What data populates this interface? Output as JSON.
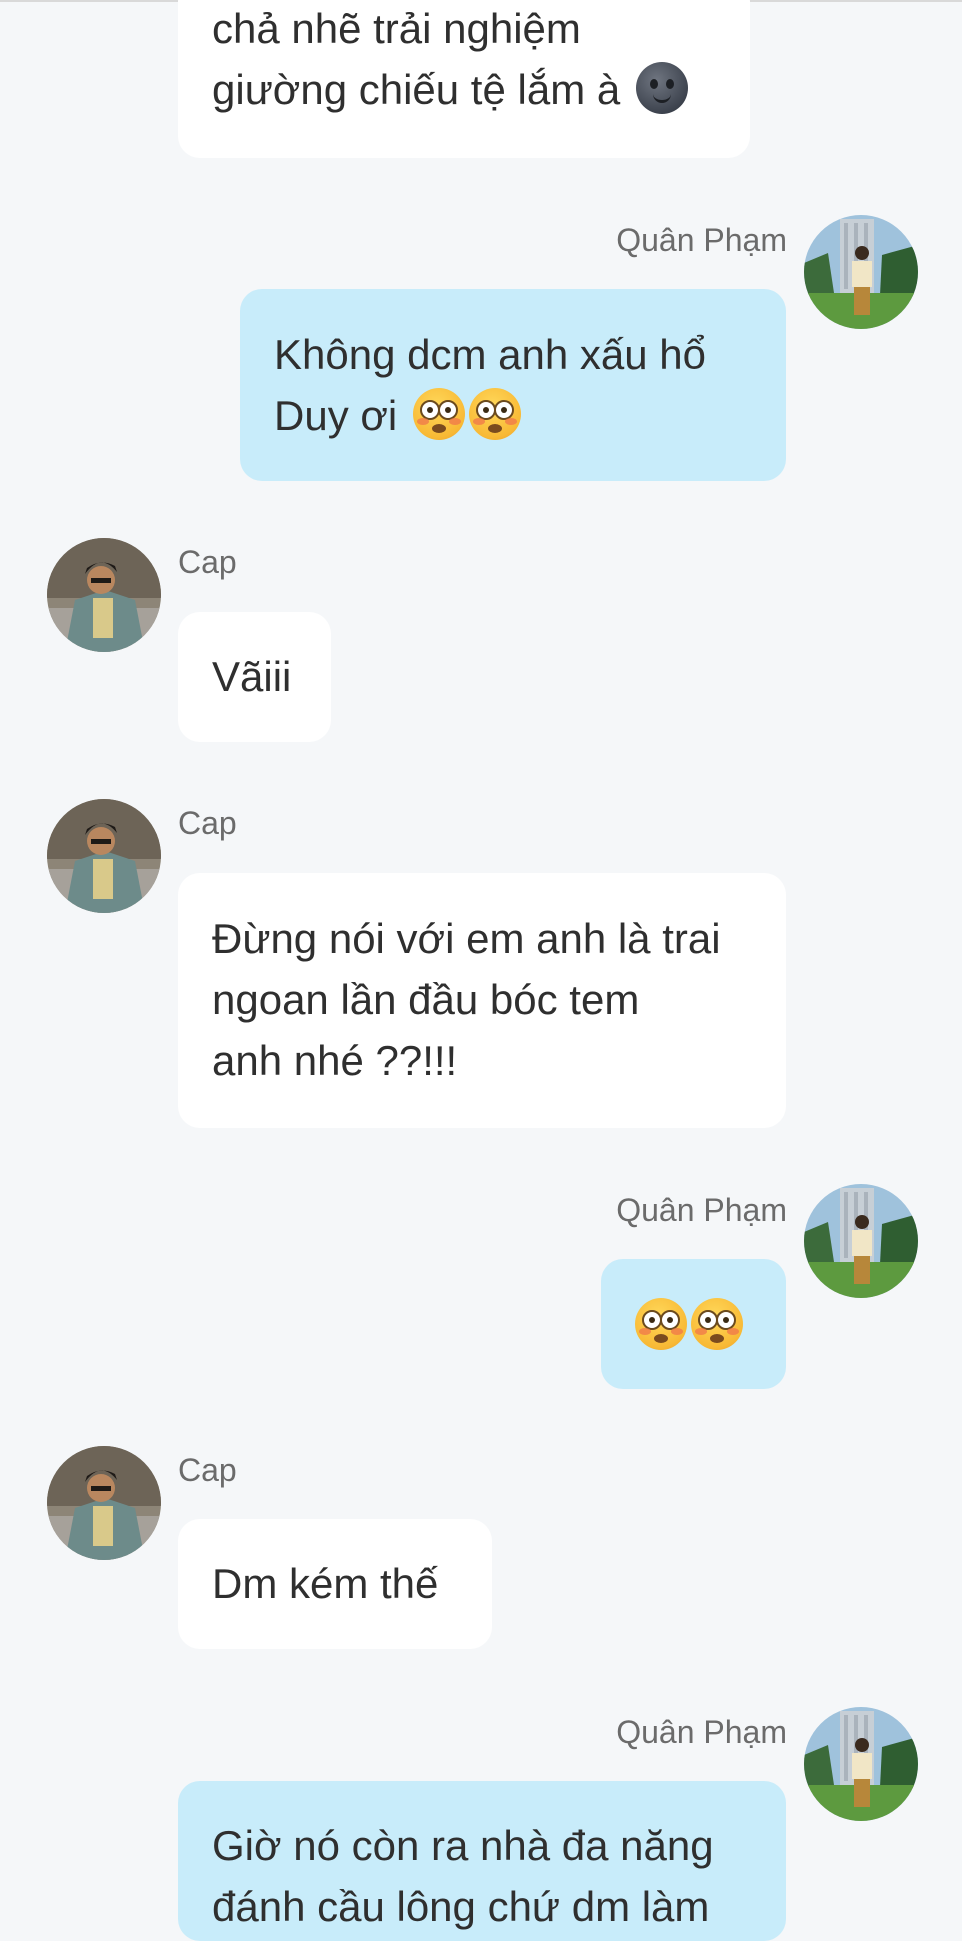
{
  "messages": [
    {
      "sender": "",
      "lines": [
        "chả nhẽ trải nghiệm",
        "giường chiếu tệ lắm à"
      ],
      "emoji": "new-moon-face-emoji"
    },
    {
      "sender": "Quân Phạm",
      "lines": [
        "Không dcm anh xấu hổ",
        "Duy ơi"
      ],
      "emoji": "flushed-face-emoji x2"
    },
    {
      "sender": "Cap",
      "lines": [
        "Vãiii"
      ]
    },
    {
      "sender": "Cap",
      "lines": [
        "Đừng nói với em anh là trai",
        "ngoan lần đầu bóc tem",
        "anh nhé ??!!!"
      ]
    },
    {
      "sender": "Quân Phạm",
      "lines": [
        ""
      ],
      "emoji": "flushed-face-emoji x2"
    },
    {
      "sender": "Cap",
      "lines": [
        "Dm kém thế"
      ]
    },
    {
      "sender": "Quân Phạm",
      "lines": [
        "Giờ nó còn ra nhà đa năng",
        "đánh cầu lông chứ dm làm"
      ]
    }
  ],
  "colors": {
    "background": "#f5f7f9",
    "incoming_bubble": "#ffffff",
    "outgoing_bubble": "#c8ecfa",
    "sender_name": "#6b6b6b"
  }
}
